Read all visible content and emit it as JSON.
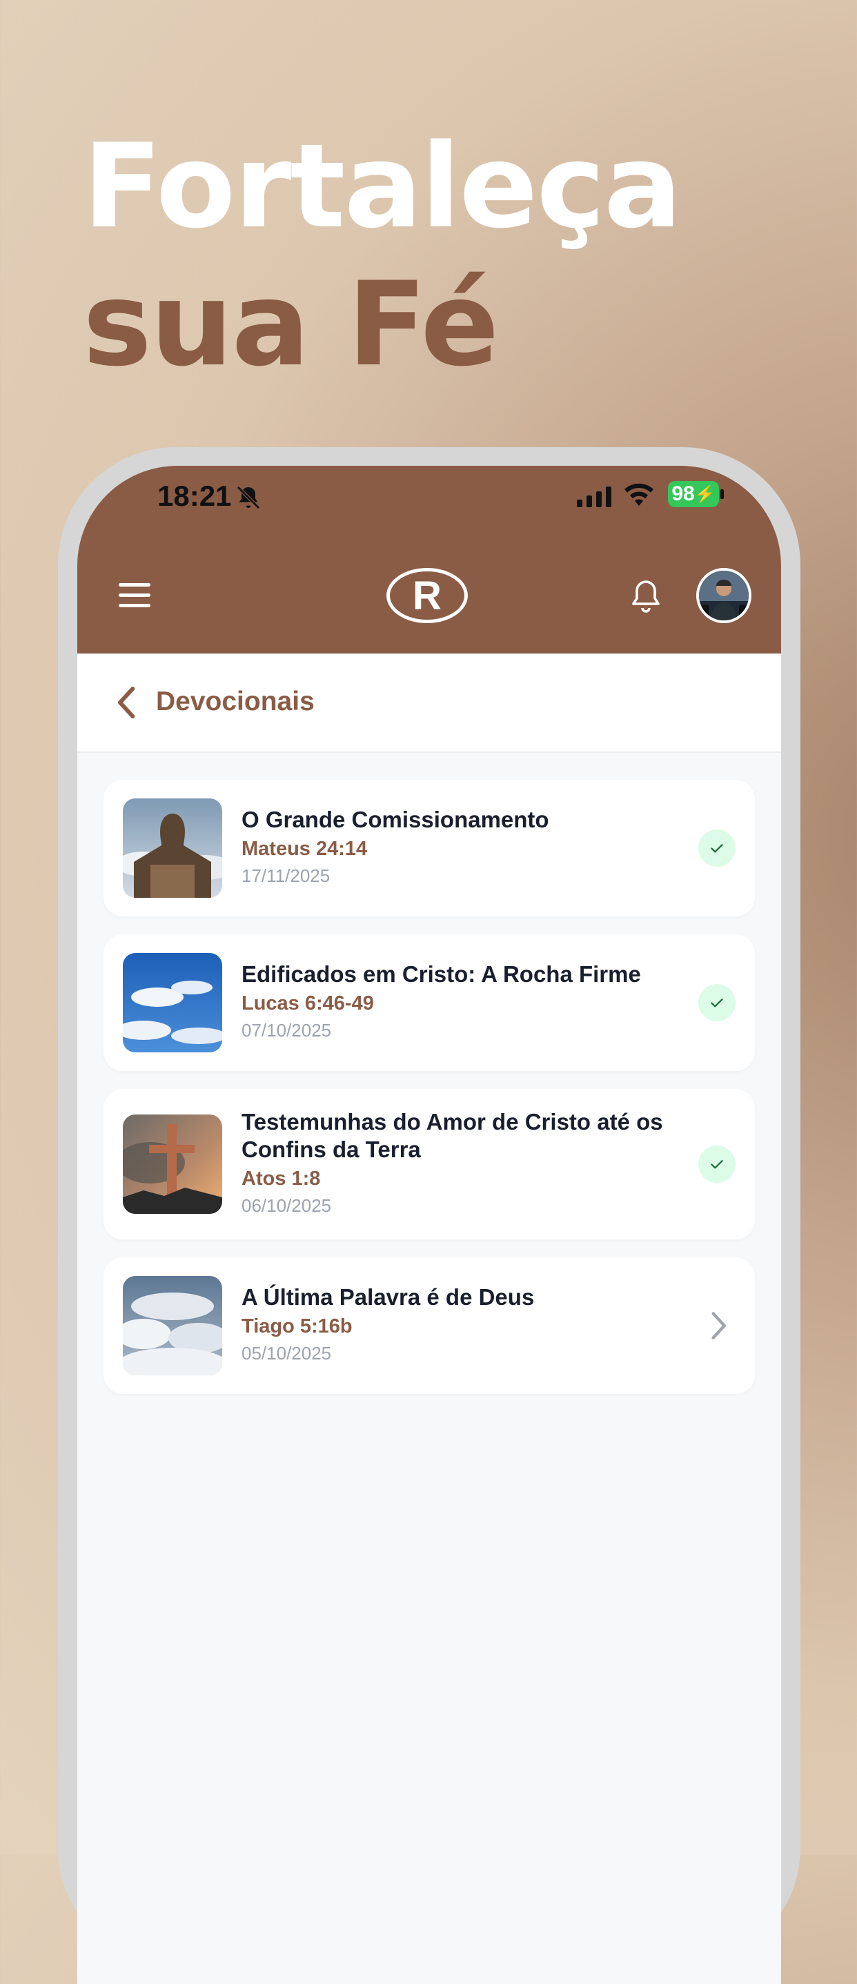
{
  "headline": {
    "line1": "Fortaleça",
    "line2": "sua Fé"
  },
  "status_bar": {
    "time": "18:21",
    "battery": "98"
  },
  "header": {
    "logo_text": "R"
  },
  "nav": {
    "title": "Devocionais"
  },
  "devotionals": [
    {
      "title": "O Grande Comissionamento",
      "reference": "Mateus 24:14",
      "date": "17/11/2025",
      "status": "completed",
      "thumbnail": "person-in-clouds"
    },
    {
      "title": "Edificados em Cristo: A Rocha Firme",
      "reference": "Lucas 6:46-49",
      "date": "07/10/2025",
      "status": "completed",
      "thumbnail": "blue-sky-clouds"
    },
    {
      "title": "Testemunhas do Amor de Cristo até os Confins da Terra",
      "reference": "Atos 1:8",
      "date": "06/10/2025",
      "status": "completed",
      "thumbnail": "cross-at-sunset"
    },
    {
      "title": "A Última Palavra é de Deus",
      "reference": "Tiago 5:16b",
      "date": "05/10/2025",
      "status": "pending",
      "thumbnail": "cloud-sky"
    }
  ],
  "colors": {
    "brand": "#8a5c46",
    "success_bg": "#dcfce7",
    "success_fg": "#166534",
    "title_text": "#1a1f2e",
    "muted_text": "#9ca3af"
  },
  "icons": [
    "bell-off-icon",
    "signal-icon",
    "wifi-icon",
    "battery-icon",
    "menu-icon",
    "logo",
    "bell-icon",
    "chevron-left-icon",
    "check-icon",
    "chevron-right-icon"
  ]
}
